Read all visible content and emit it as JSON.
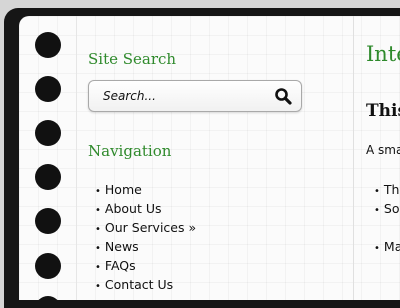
{
  "sidebar": {
    "search_title": "Site Search",
    "search_placeholder": "Search...",
    "search_icon": "magnifier-icon",
    "nav_title": "Navigation",
    "nav_items": [
      {
        "label": "Home"
      },
      {
        "label": "About Us"
      },
      {
        "label": "Our Services »"
      },
      {
        "label": "News"
      },
      {
        "label": "FAQs"
      },
      {
        "label": "Contact Us"
      }
    ]
  },
  "content": {
    "title": "Inte",
    "subtitle": "This",
    "intro": "A sma",
    "list_a": [
      "Th",
      "So"
    ],
    "list_b": [
      "Ma"
    ]
  },
  "colors": {
    "accent_green": "#2f8a2c",
    "frame": "#161616",
    "paper": "#fbfbfb"
  }
}
